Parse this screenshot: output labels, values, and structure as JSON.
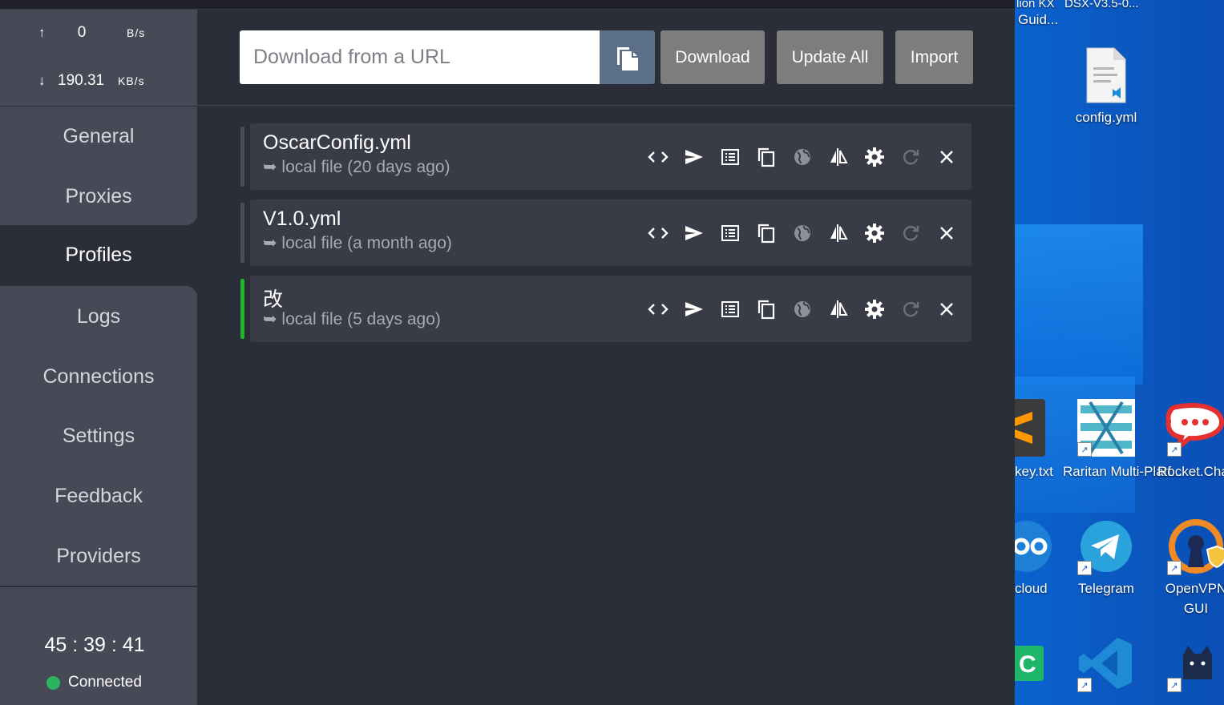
{
  "traffic": {
    "up_arrow": "↑",
    "up_value": "0",
    "up_unit": "B/s",
    "down_arrow": "↓",
    "down_value": "190.31",
    "down_unit": "KB/s"
  },
  "nav": {
    "items": [
      {
        "label": "General"
      },
      {
        "label": "Proxies"
      },
      {
        "label": "Profiles"
      },
      {
        "label": "Logs"
      },
      {
        "label": "Connections"
      },
      {
        "label": "Settings"
      },
      {
        "label": "Feedback"
      },
      {
        "label": "Providers"
      }
    ],
    "active": "Profiles"
  },
  "status": {
    "uptime": "45 : 39 : 41",
    "connection": "Connected",
    "connection_color": "#2bb35f"
  },
  "toolbar": {
    "url_placeholder": "Download from a URL",
    "download_label": "Download",
    "update_all_label": "Update All",
    "import_label": "Import"
  },
  "profiles": [
    {
      "name": "OscarConfig.yml",
      "source": "➥ local file (20 days ago)",
      "selected": false
    },
    {
      "name": "V1.0.yml",
      "source": "➥ local file (a month ago)",
      "selected": false
    },
    {
      "name": "改",
      "source": "➥ local file (5 days ago)",
      "selected": true
    }
  ],
  "profile_actions": [
    "code-icon",
    "send-icon",
    "list-icon",
    "copy-icon",
    "globe-icon",
    "compare-icon",
    "gear-icon",
    "refresh-icon",
    "close-icon"
  ],
  "desktop": {
    "top_cutoff_1": "lion KX",
    "top_cutoff_2": "DSX-V3.5-0...",
    "top_cutoff_3": "Guid...",
    "icons": [
      {
        "label": "config.yml"
      },
      {
        "label": "key.txt"
      },
      {
        "label": "Raritan Multi-Platf..."
      },
      {
        "label": "Rocket.Cha"
      },
      {
        "label": "cloud"
      },
      {
        "label": "Telegram"
      },
      {
        "label": "OpenVPN GUI"
      }
    ]
  },
  "colors": {
    "sidebar_bg": "#474a56",
    "main_bg": "#2b2d38",
    "card_bg": "#393b47",
    "selected_bar": "#20b42a",
    "button_bg": "#7d7d7d",
    "paste_bg": "#5b6f86"
  }
}
